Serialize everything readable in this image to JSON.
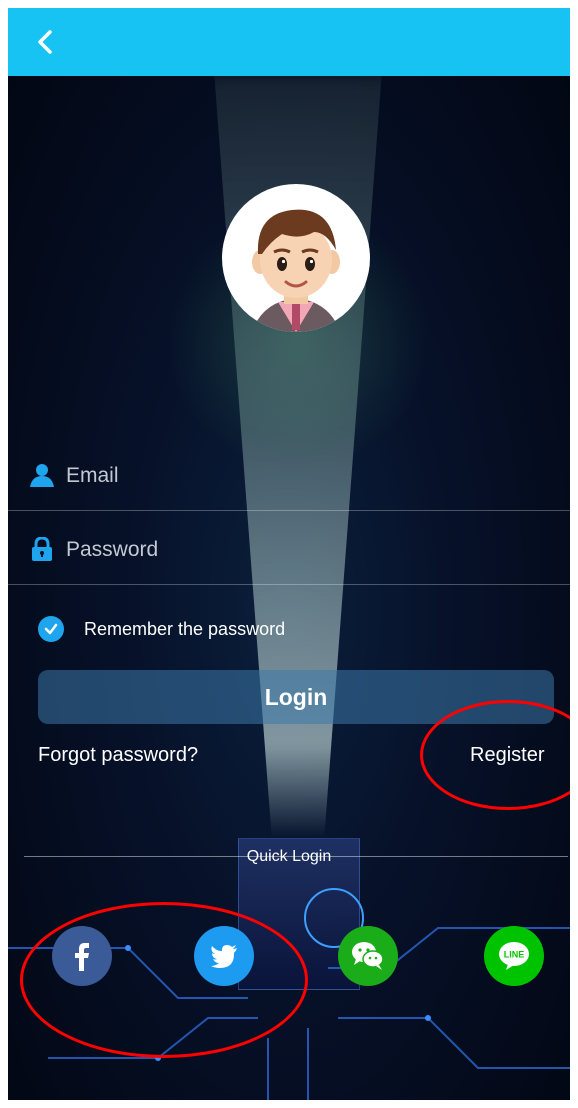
{
  "header": {
    "back_icon": "chevron-left-icon"
  },
  "form": {
    "email_placeholder": "Email",
    "password_placeholder": "Password",
    "remember_label": "Remember the password",
    "remember_checked": true,
    "login_label": "Login",
    "forgot_label": "Forgot password?",
    "register_label": "Register"
  },
  "quick_login": {
    "label": "Quick Login",
    "providers": [
      {
        "name": "facebook",
        "icon": "facebook-icon",
        "color": "#3b5a98"
      },
      {
        "name": "twitter",
        "icon": "twitter-icon",
        "color": "#1d9bf0"
      },
      {
        "name": "wechat",
        "icon": "wechat-icon",
        "color": "#1aad19"
      },
      {
        "name": "line",
        "icon": "line-icon",
        "color": "#00c300",
        "text": "LINE"
      }
    ]
  },
  "colors": {
    "header": "#17c3f3",
    "accent": "#1fa4ee",
    "annotation": "#ff0000"
  }
}
